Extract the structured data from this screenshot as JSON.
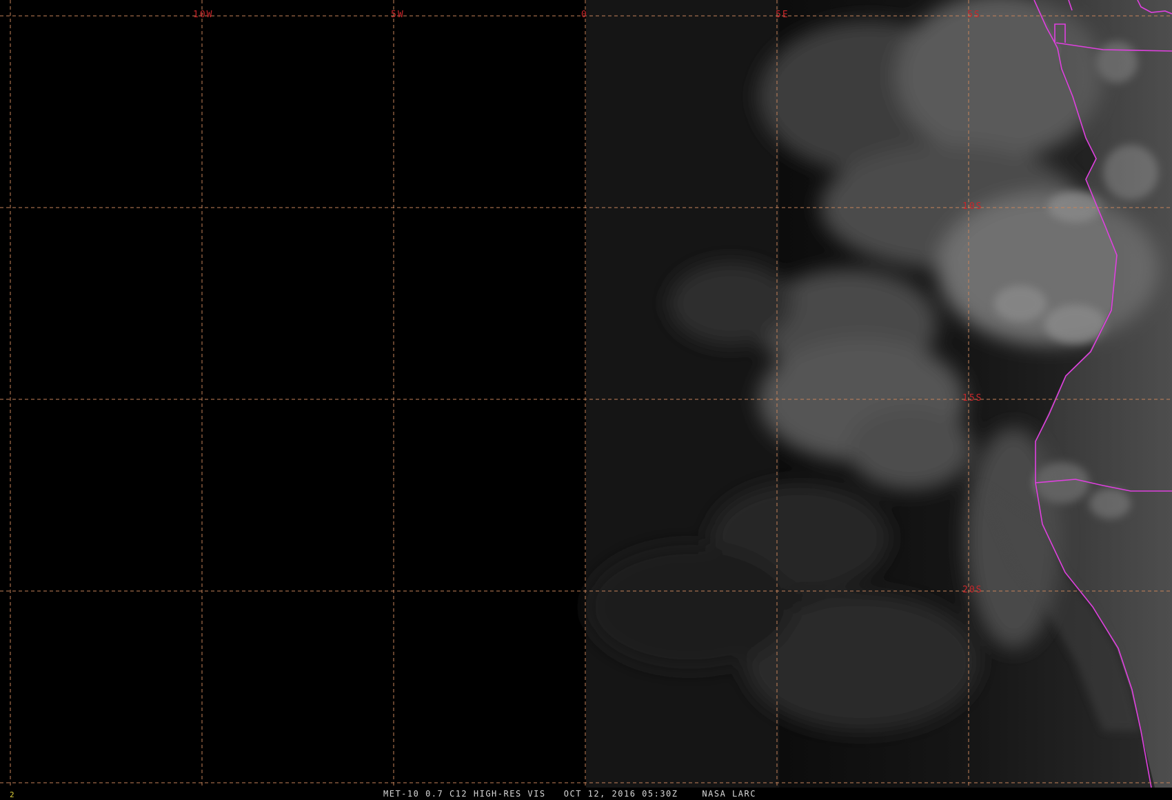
{
  "caption": "MET-10 0.7 C12 HIGH-RES VIS   OCT 12, 2016 05:30Z    NASA LARC",
  "frame_number": "2",
  "grid": {
    "longitude_labels": [
      "10W",
      "5W",
      "0",
      "5E",
      "5S"
    ],
    "latitude_labels": [
      "10S",
      "15S",
      "20S"
    ]
  },
  "colors": {
    "grid_line": "#c8845a",
    "grid_label": "#c8262a",
    "coastline": "#e040e0",
    "caption_text": "#d8d8d8",
    "frame_number": "#e0d23c",
    "background": "#000000"
  }
}
